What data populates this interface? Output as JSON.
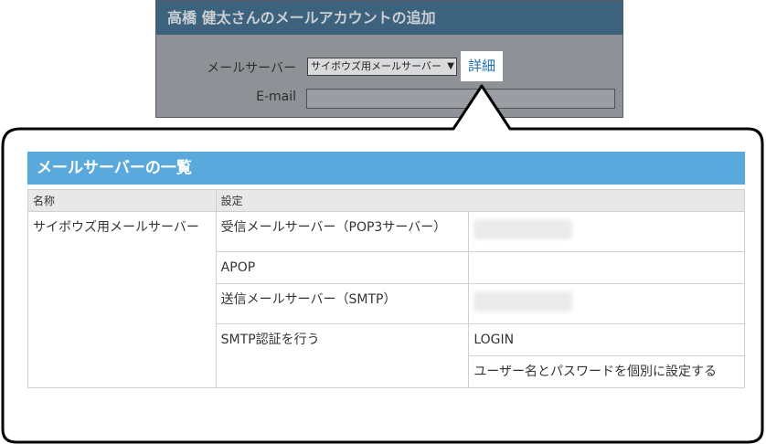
{
  "dialog": {
    "title": "高橋 健太さんのメールアカウントの追加",
    "mail_server_label": "メールサーバー",
    "mail_server_selected": "サイボウズ用メールサーバー",
    "detail_link": "詳細",
    "email_label": "E-mail",
    "email_value": ""
  },
  "panel": {
    "title": "メールサーバーの一覧",
    "columns": [
      "名称",
      "設定"
    ],
    "server_name": "サイボウズ用メールサーバー",
    "rows": [
      {
        "label": "受信メールサーバー（POP3サーバー）",
        "value": ""
      },
      {
        "label": "APOP",
        "value": ""
      },
      {
        "label": "送信メールサーバー（SMTP）",
        "value": ""
      },
      {
        "label": "SMTP認証を行う",
        "value": "LOGIN"
      },
      {
        "label": "",
        "value": "ユーザー名とパスワードを個別に設定する"
      }
    ]
  },
  "colors": {
    "header_blue": "#5aa9dc",
    "dialog_title_bg": "#3d627d",
    "link_blue": "#1f6fb0"
  }
}
